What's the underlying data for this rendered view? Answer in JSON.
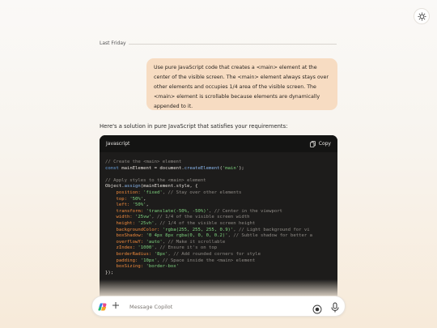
{
  "header": {
    "theme_icon": "sun-moon-icon"
  },
  "conversation": {
    "day_label": "Last Friday",
    "user_message": [
      "Use pure JavaScript code that creates a <main> element at the",
      "center of the visible screen. The <main> element always stays over",
      "other elements and occupies 1/4 area of the visible screen. The",
      "<main> element is scrollable because elements are dynamically",
      "appended to it."
    ],
    "assistant_intro": "Here's a solution in pure JavaScript that satisfies your requirements:",
    "code_block": {
      "language": "Javascript",
      "copy_label": "Copy",
      "lines": [
        [
          [
            "c",
            "// Create the <main> element"
          ]
        ],
        [
          [
            "k",
            "const "
          ],
          [
            "v",
            "mainElement = "
          ],
          [
            "v",
            "document."
          ],
          [
            "f",
            "createElement"
          ],
          [
            "v",
            "("
          ],
          [
            "s",
            "'main'"
          ],
          [
            "v",
            ");"
          ]
        ],
        [
          [
            "v",
            ""
          ]
        ],
        [
          [
            "c",
            "// Apply styles to the <main> element"
          ]
        ],
        [
          [
            "v",
            "Object."
          ],
          [
            "f",
            "assign"
          ],
          [
            "v",
            "(mainElement.style, {"
          ]
        ],
        [
          [
            "p",
            "    position: "
          ],
          [
            "s",
            "'fixed'"
          ],
          [
            "c",
            ", // Stay over other elements"
          ]
        ],
        [
          [
            "p",
            "    top: "
          ],
          [
            "s",
            "'50%'"
          ],
          [
            "v",
            ","
          ]
        ],
        [
          [
            "p",
            "    left: "
          ],
          [
            "s",
            "'50%'"
          ],
          [
            "v",
            ","
          ]
        ],
        [
          [
            "p",
            "    transform: "
          ],
          [
            "s",
            "'translate(-50%, -50%)'"
          ],
          [
            "c",
            ", // Center in the viewport"
          ]
        ],
        [
          [
            "p",
            "    width: "
          ],
          [
            "s",
            "'25vw'"
          ],
          [
            "c",
            ", // 1/4 of the visible screen width"
          ]
        ],
        [
          [
            "p",
            "    height: "
          ],
          [
            "s",
            "'25vh'"
          ],
          [
            "c",
            ", // 1/4 of the visible screen height"
          ]
        ],
        [
          [
            "p",
            "    backgroundColor: "
          ],
          [
            "s",
            "'rgba(255, 255, 255, 0.9)'"
          ],
          [
            "c",
            ", // Light background for vi"
          ]
        ],
        [
          [
            "p",
            "    boxShadow: "
          ],
          [
            "s",
            "'0 4px 8px rgba(0, 0, 0, 0.2)'"
          ],
          [
            "c",
            ", // Subtle shadow for better a"
          ]
        ],
        [
          [
            "p",
            "    overflowY: "
          ],
          [
            "s",
            "'auto'"
          ],
          [
            "c",
            ", // Make it scrollable"
          ]
        ],
        [
          [
            "p",
            "    zIndex: "
          ],
          [
            "s",
            "'1000'"
          ],
          [
            "c",
            ", // Ensure it's on top"
          ]
        ],
        [
          [
            "p",
            "    borderRadius: "
          ],
          [
            "s",
            "'8px'"
          ],
          [
            "c",
            ", // Add rounded corners for style"
          ]
        ],
        [
          [
            "p",
            "    padding: "
          ],
          [
            "s",
            "'10px'"
          ],
          [
            "c",
            ", // Space inside the <main> element"
          ]
        ],
        [
          [
            "p",
            "    boxSizing: "
          ],
          [
            "s",
            "'border-box'"
          ]
        ],
        [
          [
            "v",
            "});"
          ]
        ]
      ]
    }
  },
  "composer": {
    "placeholder": "Message Copilot",
    "value": ""
  },
  "colors": {
    "user_bubble": "#f7dcc2",
    "code_bg": "#1d1c1b",
    "code_property": "#f08a3c",
    "code_string": "#7fd37f"
  }
}
